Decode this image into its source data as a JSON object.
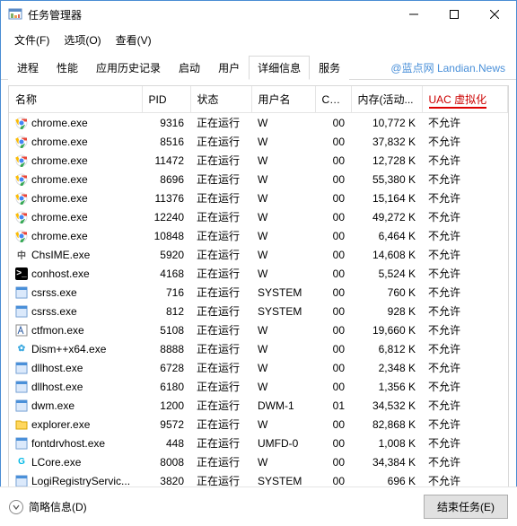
{
  "window": {
    "title": "任务管理器"
  },
  "menu": {
    "file": "文件(F)",
    "options": "选项(O)",
    "view": "查看(V)"
  },
  "tabs": {
    "items": [
      "进程",
      "性能",
      "应用历史记录",
      "启动",
      "用户",
      "详细信息",
      "服务"
    ],
    "active": 5
  },
  "watermark": "@蓝点网 Landian.News",
  "columns": {
    "name": "名称",
    "pid": "PID",
    "status": "状态",
    "user": "用户名",
    "cpu": "CPU",
    "memory": "内存(活动...",
    "uac": "UAC 虚拟化"
  },
  "processes": [
    {
      "icon": "chrome",
      "name": "chrome.exe",
      "pid": "9316",
      "status": "正在运行",
      "user": "W",
      "cpu": "00",
      "mem": "10,772 K",
      "uac": "不允许"
    },
    {
      "icon": "chrome",
      "name": "chrome.exe",
      "pid": "8516",
      "status": "正在运行",
      "user": "W",
      "cpu": "00",
      "mem": "37,832 K",
      "uac": "不允许"
    },
    {
      "icon": "chrome",
      "name": "chrome.exe",
      "pid": "11472",
      "status": "正在运行",
      "user": "W",
      "cpu": "00",
      "mem": "12,728 K",
      "uac": "不允许"
    },
    {
      "icon": "chrome",
      "name": "chrome.exe",
      "pid": "8696",
      "status": "正在运行",
      "user": "W",
      "cpu": "00",
      "mem": "55,380 K",
      "uac": "不允许"
    },
    {
      "icon": "chrome",
      "name": "chrome.exe",
      "pid": "11376",
      "status": "正在运行",
      "user": "W",
      "cpu": "00",
      "mem": "15,164 K",
      "uac": "不允许"
    },
    {
      "icon": "chrome",
      "name": "chrome.exe",
      "pid": "12240",
      "status": "正在运行",
      "user": "W",
      "cpu": "00",
      "mem": "49,272 K",
      "uac": "不允许"
    },
    {
      "icon": "chrome",
      "name": "chrome.exe",
      "pid": "10848",
      "status": "正在运行",
      "user": "W",
      "cpu": "00",
      "mem": "6,464 K",
      "uac": "不允许"
    },
    {
      "icon": "ime",
      "name": "ChsIME.exe",
      "pid": "5920",
      "status": "正在运行",
      "user": "W",
      "cpu": "00",
      "mem": "14,608 K",
      "uac": "不允许"
    },
    {
      "icon": "conhost",
      "name": "conhost.exe",
      "pid": "4168",
      "status": "正在运行",
      "user": "W",
      "cpu": "00",
      "mem": "5,524 K",
      "uac": "不允许"
    },
    {
      "icon": "generic",
      "name": "csrss.exe",
      "pid": "716",
      "status": "正在运行",
      "user": "SYSTEM",
      "cpu": "00",
      "mem": "760 K",
      "uac": "不允许"
    },
    {
      "icon": "generic",
      "name": "csrss.exe",
      "pid": "812",
      "status": "正在运行",
      "user": "SYSTEM",
      "cpu": "00",
      "mem": "928 K",
      "uac": "不允许"
    },
    {
      "icon": "ctfmon",
      "name": "ctfmon.exe",
      "pid": "5108",
      "status": "正在运行",
      "user": "W",
      "cpu": "00",
      "mem": "19,660 K",
      "uac": "不允许"
    },
    {
      "icon": "dism",
      "name": "Dism++x64.exe",
      "pid": "8888",
      "status": "正在运行",
      "user": "W",
      "cpu": "00",
      "mem": "6,812 K",
      "uac": "不允许"
    },
    {
      "icon": "generic",
      "name": "dllhost.exe",
      "pid": "6728",
      "status": "正在运行",
      "user": "W",
      "cpu": "00",
      "mem": "2,348 K",
      "uac": "不允许"
    },
    {
      "icon": "generic",
      "name": "dllhost.exe",
      "pid": "6180",
      "status": "正在运行",
      "user": "W",
      "cpu": "00",
      "mem": "1,356 K",
      "uac": "不允许"
    },
    {
      "icon": "generic",
      "name": "dwm.exe",
      "pid": "1200",
      "status": "正在运行",
      "user": "DWM-1",
      "cpu": "01",
      "mem": "34,532 K",
      "uac": "不允许"
    },
    {
      "icon": "explorer",
      "name": "explorer.exe",
      "pid": "9572",
      "status": "正在运行",
      "user": "W",
      "cpu": "00",
      "mem": "82,868 K",
      "uac": "不允许"
    },
    {
      "icon": "generic",
      "name": "fontdrvhost.exe",
      "pid": "448",
      "status": "正在运行",
      "user": "UMFD-0",
      "cpu": "00",
      "mem": "1,008 K",
      "uac": "不允许"
    },
    {
      "icon": "lcore",
      "name": "LCore.exe",
      "pid": "8008",
      "status": "正在运行",
      "user": "W",
      "cpu": "00",
      "mem": "34,384 K",
      "uac": "不允许"
    },
    {
      "icon": "generic",
      "name": "LogiRegistryServic...",
      "pid": "3820",
      "status": "正在运行",
      "user": "SYSTEM",
      "cpu": "00",
      "mem": "696 K",
      "uac": "不允许"
    }
  ],
  "footer": {
    "brief": "简略信息(D)",
    "end_task": "结束任务(E)"
  },
  "icons": {
    "chrome": {
      "bg": "#fff",
      "svg": "<circle cx='7' cy='7' r='6' fill='#fff' stroke='#dadce0'/><circle cx='7' cy='7' r='3' fill='#4285f4'/><path d='M7 4 L13 4' stroke='#ea4335' stroke-width='3'/><path d='M4.4 8.5 L1.5 3' stroke='#fbbc05' stroke-width='3'/><path d='M9.6 8.5 L6.5 14' stroke='#34a853' stroke-width='3'/><circle cx='7' cy='7' r='3' fill='#4285f4' stroke='#fff'/>"
    },
    "ime": {
      "bg": "#fff",
      "text": "中",
      "color": "#555"
    },
    "conhost": {
      "bg": "#000",
      "text": ">_",
      "color": "#fff"
    },
    "generic": {
      "bg": "#e8f0fe",
      "svg": "<rect x='1' y='1' width='12' height='12' fill='#dbe9fb' stroke='#7fa7d4'/><rect x='1' y='1' width='12' height='3' fill='#4a90d9'/>"
    },
    "ctfmon": {
      "bg": "#fff",
      "svg": "<rect x='1' y='1' width='12' height='12' fill='#fff' stroke='#888'/><path d='M3 11 L6 3 L9 11 M4 8 h4' stroke='#2c5aa0' fill='none'/>"
    },
    "dism": {
      "bg": "#fff",
      "text": "✿",
      "color": "#3ba9e0"
    },
    "explorer": {
      "bg": "#fff",
      "svg": "<path d='M1 3 h5 l1 1 h6 v8 h-12 z' fill='#ffd75e' stroke='#d9a400'/>"
    },
    "lcore": {
      "bg": "#fff",
      "text": "G",
      "color": "#00b8e6"
    }
  }
}
